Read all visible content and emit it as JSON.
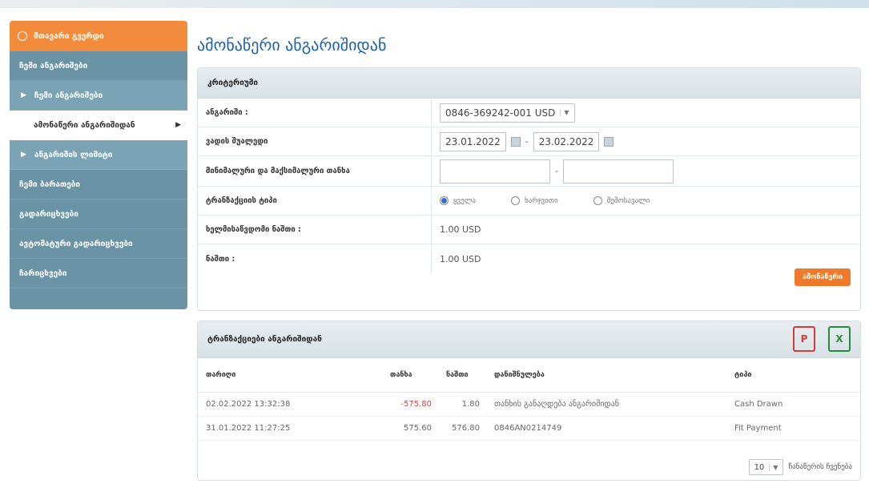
{
  "sidebar": {
    "home": "მთავარი გვერდი",
    "items": [
      {
        "label": "ჩემი ანგარიშები",
        "type": "plain"
      },
      {
        "label": "ჩემი ანგარიშები",
        "type": "sub"
      },
      {
        "label": "ამონაწერი ანგარიშიდან",
        "type": "active"
      },
      {
        "label": "ანგარიშის ლიმიტი",
        "type": "sub"
      },
      {
        "label": "ჩემი ბარათები",
        "type": "plain"
      },
      {
        "label": "გადარიცხვები",
        "type": "plain"
      },
      {
        "label": "ავტომატური გადარიცხვები",
        "type": "plain"
      },
      {
        "label": "ჩარიცხვები",
        "type": "plain"
      }
    ]
  },
  "title": "ამონაწერი ანგარიშიდან",
  "criteria": {
    "header": "კრიტერიუმი",
    "account_label": "ანგარიში :",
    "account_value": "0846-369242-001 USD",
    "period_label": "ვადის შუალედი",
    "date_from": "23.01.2022",
    "date_to": "23.02.2022",
    "amount_label": "მინიმალური და მაქსიმალური თანხა",
    "type_label": "ტრანზაქციის ტიპი",
    "radio_all": "ყველა",
    "radio_debit": "ხარჯვითი",
    "radio_credit": "შემოსავალი",
    "available_label": "ხელმისაწვდომი ნაშთი :",
    "available_value": "1.00 USD",
    "balance_label": "ნაშთი :",
    "balance_value": "1.00 USD",
    "search_button": "ამონაწერი"
  },
  "transactions": {
    "header": "ტრანზაქციები ანგარიშიდან",
    "columns": [
      "თარიღი",
      "თანხა",
      "ნაშთი",
      "დანიშნულება",
      "ტიპი"
    ],
    "rows": [
      {
        "date": "02.02.2022 13:32:38",
        "amount": "-575.80",
        "balance": "1.80",
        "desc": "თანხის განაღდება ანგარიშიდან",
        "type": "Cash Drawn"
      },
      {
        "date": "31.01.2022 11:27:25",
        "amount": "575.60",
        "balance": "576.80",
        "desc": "0846AN0214749",
        "type": "Fit Payment"
      }
    ],
    "pager_value": "10",
    "pager_label": "ჩანაწერის ჩვენება"
  },
  "colors": {
    "accent": "#f07a2c",
    "sidebar": "#6a94a6",
    "title": "#1b5fa8"
  }
}
